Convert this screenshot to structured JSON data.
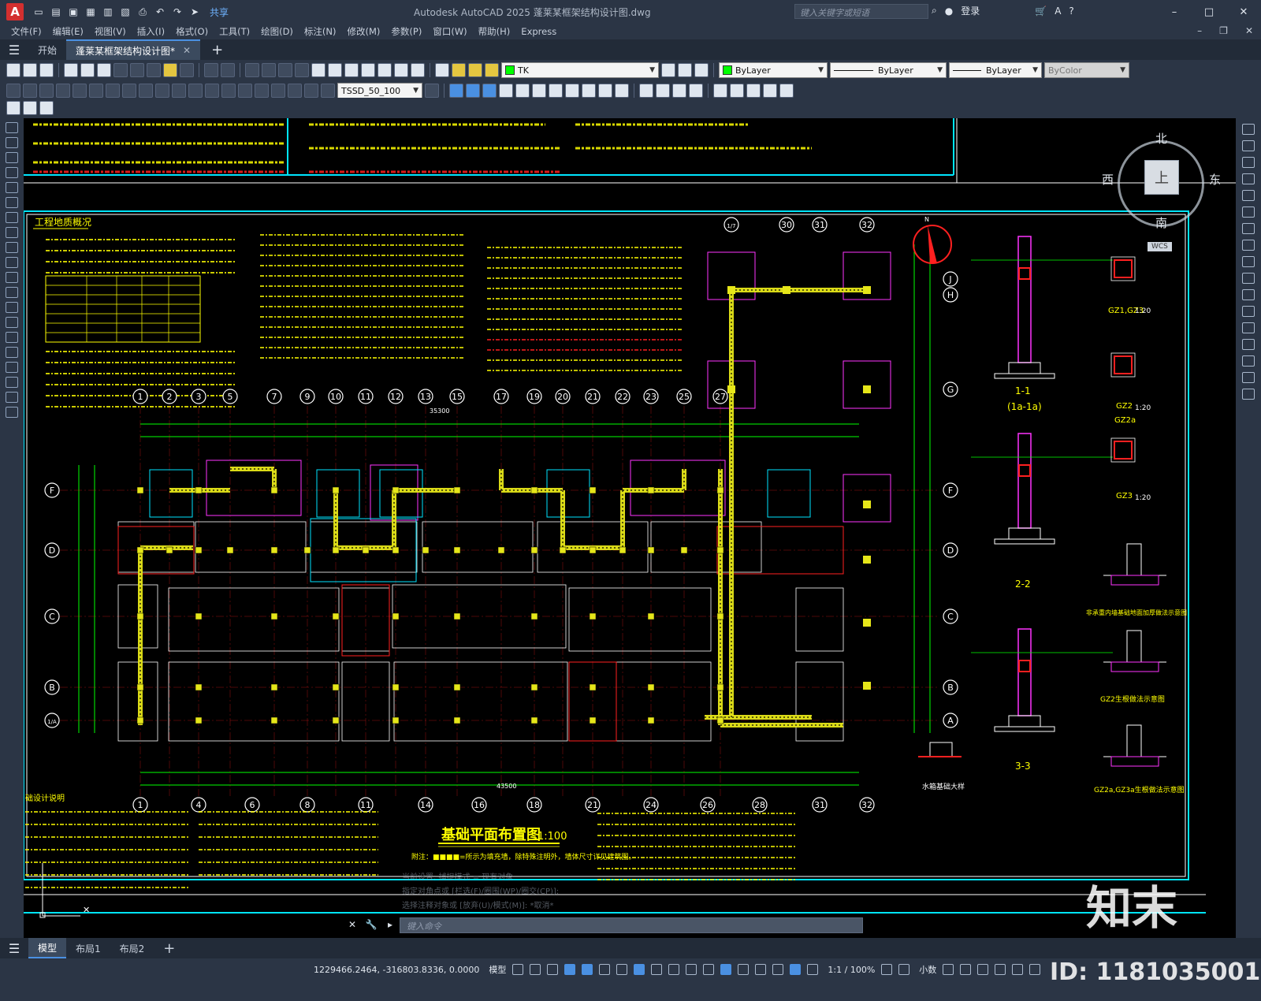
{
  "titlebar": {
    "logo": "A",
    "share": "共享",
    "title": "Autodesk AutoCAD 2025    蓬莱某框架结构设计图.dwg",
    "search_placeholder": "键入关键字或短语",
    "login": "登录",
    "minimize": "–",
    "maximize": "□",
    "close": "✕"
  },
  "menubar": {
    "items": [
      "文件(F)",
      "编辑(E)",
      "视图(V)",
      "插入(I)",
      "格式(O)",
      "工具(T)",
      "绘图(D)",
      "标注(N)",
      "修改(M)",
      "参数(P)",
      "窗口(W)",
      "帮助(H)",
      "Express"
    ],
    "ctl_min": "–",
    "ctl_restore": "❐",
    "ctl_close": "✕"
  },
  "tabs": {
    "start": "开始",
    "active": "蓬莱某框架结构设计图*",
    "close": "✕",
    "add": "+"
  },
  "toolbar2": {
    "layer": "TK",
    "color": "ByLayer",
    "linetype": "ByLayer",
    "lineweight": "ByLayer",
    "plotstyle": "ByColor"
  },
  "toolbar3": {
    "dimstyle": "TSSD_50_100"
  },
  "viewcube": {
    "north": "北",
    "south": "南",
    "east": "东",
    "west": "西",
    "top": "上",
    "wcs": "WCS"
  },
  "drawing": {
    "title": "基础平面布置图",
    "scale": "1:100",
    "note": "附注：■■■■=所示为填充墙，除特殊注明外，墙体尺寸详见建筑图。",
    "geo_title": "工程地质概况",
    "design_title": "础设计说明",
    "section_labels": [
      "1-1",
      "(1a-1a)",
      "2-2",
      "3-3"
    ],
    "detail_labels": [
      "GZ1,GZ3",
      "1:20",
      "GZ2",
      "1:20",
      "GZ2a",
      "GZ3",
      "1:20",
      "水箱基础大样",
      "GZ2生根做法示意图",
      "GZ2a,GZ3a生根做法示意图",
      "非承重内墙基础地面加厚做法示意图"
    ],
    "axis_top": [
      "1",
      "2",
      "3",
      "5",
      "7",
      "9",
      "10",
      "11",
      "12",
      "13",
      "15",
      "17",
      "19",
      "20",
      "21",
      "22",
      "23",
      "25",
      "27"
    ],
    "axis_top_right": [
      "1/7",
      "30",
      "31",
      "32"
    ],
    "axis_bottom": [
      "1",
      "4",
      "6",
      "8",
      "11",
      "14",
      "16",
      "18",
      "21",
      "24",
      "26",
      "28",
      "31",
      "32"
    ],
    "axis_left": [
      "F",
      "D",
      "C",
      "B",
      "1/A"
    ],
    "axis_right": [
      "J",
      "H",
      "G",
      "F",
      "D",
      "C",
      "B",
      "A"
    ],
    "total_top": "35300",
    "total_bottom": "43500",
    "history": [
      "当前设置: 捕捉模式 = 现有对象",
      "指定对角点或 [栏选(F)/圈围(WP)/圈交(CP)]:",
      "选择注释对象或 [放弃(U)/模式(M)]: *取消*"
    ]
  },
  "command": {
    "placeholder": "键入命令"
  },
  "layout_tabs": [
    "模型",
    "布局1",
    "布局2"
  ],
  "layout_add": "+",
  "status": {
    "coords": "1229466.2464, -316803.8336, 0.0000",
    "model": "模型",
    "scale": "1:1 / 100%",
    "units": "小数"
  },
  "watermark": {
    "brand": "知末",
    "id": "ID: 1181035001"
  },
  "colors": {
    "background": "#000000",
    "cyan_frame": "#00e5ff",
    "wall_yellow": "#e6e619",
    "axis_white": "#ffffff",
    "dim_green": "#00ff00",
    "magenta": "#ff33ff",
    "red": "#ff2020"
  }
}
